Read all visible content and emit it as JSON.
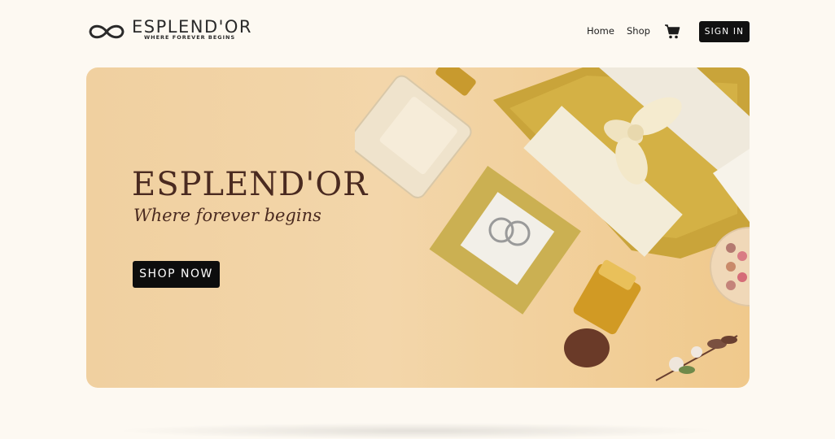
{
  "brand": {
    "name": "ESPLEND'OR",
    "tagline": "WHERE FOREVER BEGINS",
    "logo_icon": "infinity-icon"
  },
  "nav": {
    "home_label": "Home",
    "shop_label": "Shop",
    "cart_icon": "cart-icon",
    "signin_label": "SIGN IN"
  },
  "hero": {
    "title": "ESPLEND'OR",
    "subtitle": "Where forever begins",
    "cta_label": "SHOP NOW"
  },
  "colors": {
    "background": "#fdf9f2",
    "hero_bg": "#f3d6aa",
    "accent_dark": "#4a2a20",
    "button": "#111111",
    "gold": "#c9a43a"
  }
}
